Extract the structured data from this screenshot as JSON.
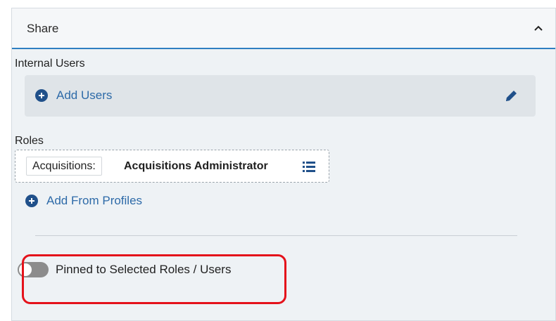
{
  "share": {
    "title": "Share",
    "collapse_icon": "chevron-up-icon",
    "internal_users": {
      "label": "Internal Users",
      "add_label": "Add Users",
      "add_icon": "plus-circle-icon",
      "edit_icon": "pencil-icon"
    },
    "roles": {
      "label": "Roles",
      "items": [
        {
          "prefix": "Acquisitions:",
          "name": "Acquisitions Administrator",
          "icon": "list-icon"
        }
      ],
      "add_label": "Add From Profiles",
      "add_icon": "plus-circle-icon"
    },
    "pinned_toggle": {
      "label": "Pinned to Selected Roles / Users",
      "state": "off"
    }
  },
  "colors": {
    "accent": "#2f7fc1",
    "link": "#2d6aa8",
    "icon_fill": "#20508a",
    "highlight": "#e4121b",
    "toggle_off": "#8c8c8c"
  }
}
